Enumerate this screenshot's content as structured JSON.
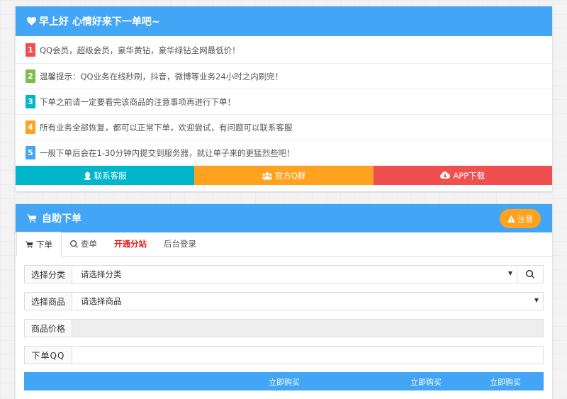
{
  "greeting": {
    "title": "早上好 心情好来下一单吧~"
  },
  "notices": [
    {
      "num": "1",
      "text": "QQ会员，超级会员，豪华黄钻，豪华绿钻全网最低价！"
    },
    {
      "num": "2",
      "text": "温馨提示：QQ业务在线秒刷，抖音，微博等业务24小时之内刷完！"
    },
    {
      "num": "3",
      "text": "下单之前请一定要看完该商品的注意事项再进行下单！"
    },
    {
      "num": "4",
      "text": "所有业务全部恢复，都可以正常下单，欢迎尝试，有问题可以联系客服"
    },
    {
      "num": "5",
      "text": "一般下单后会在1-30分钟内提交到服务器，就让单子来的更猛烈些吧！"
    }
  ],
  "actions": {
    "kefu": "联系客服",
    "qq_group": "官方Q群",
    "app": "APP下载"
  },
  "order": {
    "title": "自助下单",
    "notice_btn": "注意",
    "tabs": [
      "下单",
      "查单",
      "开通分站",
      "后台登录"
    ],
    "category_label": "选择分类",
    "category_value": "请选择分类",
    "product_label": "选择商品",
    "product_value": "请选择商品",
    "price_label": "商品价格",
    "qq_label": "下单QQ",
    "buy_label_1": "立即购买",
    "buy_label_2": "立即购买",
    "buy_label_3": "立即购买"
  },
  "colors": {
    "primary": "#42a5f5",
    "cyan": "#00b7c9",
    "orange": "#ffa21f",
    "red": "#ef4f4f",
    "green": "#7cbd4c"
  }
}
